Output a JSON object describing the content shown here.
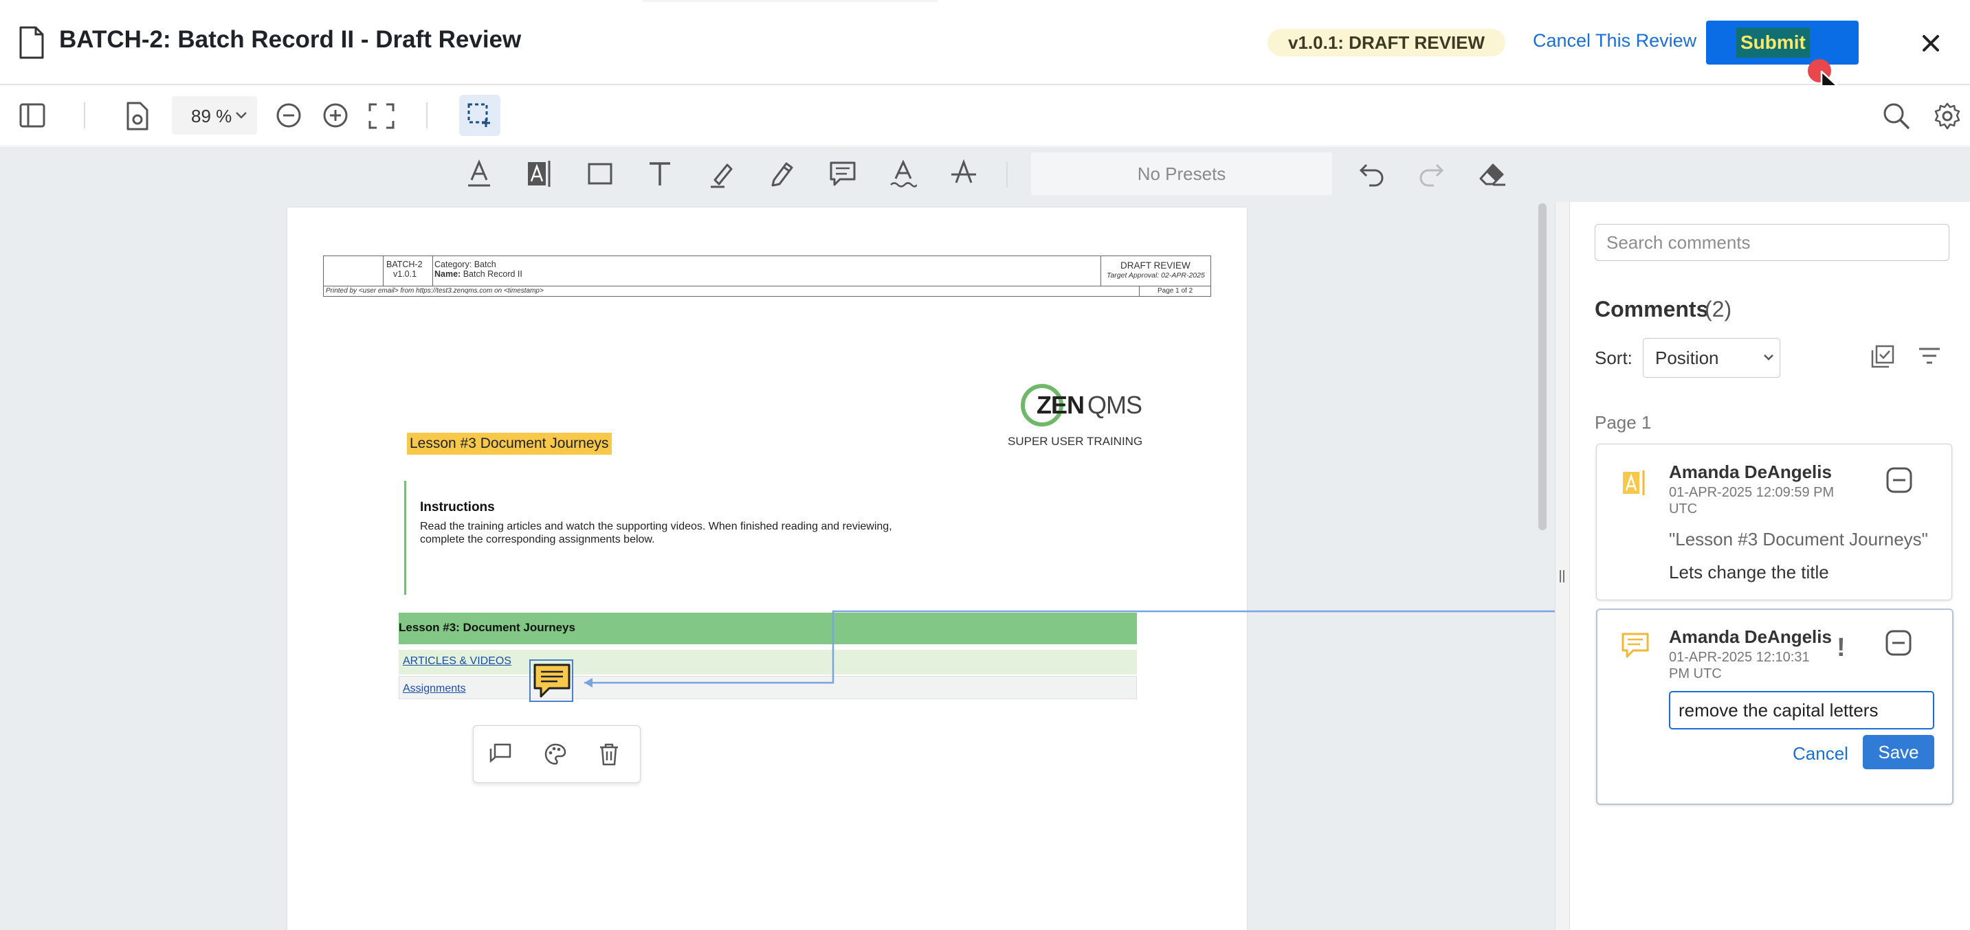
{
  "header": {
    "title": "BATCH-2: Batch Record II - Draft Review",
    "version_badge": "v1.0.1: DRAFT REVIEW",
    "cancel_label": "Cancel This Review",
    "submit_label": "Submit",
    "icons": {
      "document": "document-icon",
      "close": "close-icon",
      "cursor": "mouse-pointer-icon"
    }
  },
  "toolbar": {
    "zoom": "89 %",
    "icons": [
      "sidebar-toggle-icon",
      "page-settings-icon",
      "chevron-down-icon",
      "zoom-out-icon",
      "zoom-in-icon",
      "fullscreen-icon",
      "selection-tool-icon",
      "search-icon",
      "settings-icon"
    ]
  },
  "annotation_toolbar": {
    "presets": "No Presets",
    "tools": [
      "text-underline-icon",
      "text-highlight-icon",
      "rectangle-icon",
      "text-icon",
      "pen-icon",
      "free-hand-icon",
      "comment-icon",
      "squiggly-icon",
      "strikeout-icon",
      "undo-icon",
      "redo-icon",
      "eraser-icon"
    ]
  },
  "document": {
    "header": {
      "code": "BATCH-2",
      "version": "v1.0.1",
      "category_label": "Category:",
      "category_value": "Batch",
      "name_label": "Name:",
      "name_value": "Batch Record II",
      "status": "DRAFT REVIEW",
      "target_approval": "Target Approval: 02-APR-2025",
      "printed_by": "Printed by <user email> from https://test3.zenqms.com on <timestamp>",
      "page": "Page 1 of 2"
    },
    "logo_text": "ZENQMS",
    "logo_zen": "ZEN",
    "logo_qms": "QMS",
    "logo_subtitle": "SUPER USER TRAINING",
    "lesson_title": "Lesson #3 Document Journeys",
    "instructions_title": "Instructions",
    "instructions_line1": "Read the training articles and watch the supporting videos. When finished reading and reviewing,",
    "instructions_line2": "complete the corresponding assignments below.",
    "lesson_bar": "Lesson #3: Document Journeys",
    "link_articles": "ARTICLES & VIDEOS",
    "link_assignments": "Assignments",
    "popup_icons": [
      "reply-icon",
      "palette-icon",
      "trash-icon"
    ]
  },
  "comments_panel": {
    "search_placeholder": "Search comments",
    "title": "Comments",
    "count": "(2)",
    "sort_label": "Sort:",
    "sort_value": "Position",
    "group_label": "Page 1",
    "icons": [
      "checklist-icon",
      "filter-icon"
    ],
    "comments": [
      {
        "author": "Amanda DeAngelis",
        "timestamp_line1": "01-APR-2025 12:09:59 PM",
        "timestamp_line2": "UTC",
        "quote": "\"Lesson #3 Document Journeys\"",
        "body": "Lets change the title",
        "type_icon": "highlight-comment-icon",
        "status_icon": "collapse-icon"
      },
      {
        "author": "Amanda DeAngelis",
        "timestamp_line1": "01-APR-2025 12:10:31",
        "timestamp_line2": "PM UTC",
        "priority": "!",
        "reply_value": "remove the capital letters",
        "cancel_label": "Cancel",
        "save_label": "Save",
        "type_icon": "note-comment-icon",
        "status_icon": "collapse-icon"
      }
    ]
  },
  "colors": {
    "accent": "#1a6fd6",
    "submit": "#0a6de6",
    "highlight": "#f7c84a",
    "lesson_bar": "#82c785",
    "badge_bg": "#fbf5d4"
  }
}
